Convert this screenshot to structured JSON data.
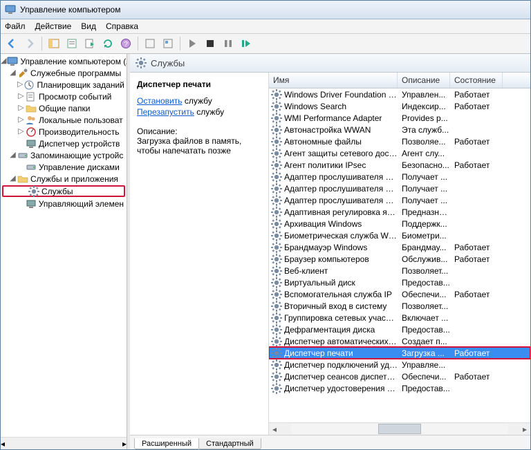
{
  "window": {
    "title": "Управление компьютером"
  },
  "menu": {
    "file": "Файл",
    "action": "Действие",
    "view": "Вид",
    "help": "Справка"
  },
  "tree": {
    "root": "Управление компьютером (л",
    "g1": "Служебные программы",
    "n1": "Планировщик заданий",
    "n2": "Просмотр событий",
    "n3": "Общие папки",
    "n4": "Локальные пользоват",
    "n5": "Производительность",
    "n6": "Диспетчер устройств",
    "g2": "Запоминающие устройс",
    "n7": "Управление дисками",
    "g3": "Службы и приложения",
    "n8": "Службы",
    "n9": "Управляющий элемен"
  },
  "panel": {
    "header": "Службы",
    "selected": "Диспетчер печати",
    "action1_link": "Остановить",
    "action1_rest": " службу",
    "action2_link": "Перезапустить",
    "action2_rest": " службу",
    "desc_h": "Описание:",
    "desc": "Загрузка файлов в память, чтобы напечатать позже"
  },
  "columns": {
    "name": "Имя",
    "desc": "Описание",
    "state": "Состояние"
  },
  "services": [
    {
      "n": "Windows Driver Foundation - User...",
      "d": "Управлен...",
      "s": "Работает"
    },
    {
      "n": "Windows Search",
      "d": "Индексир...",
      "s": "Работает"
    },
    {
      "n": "WMI Performance Adapter",
      "d": "Provides p...",
      "s": ""
    },
    {
      "n": "Автонастройка WWAN",
      "d": "Эта служб...",
      "s": ""
    },
    {
      "n": "Автономные файлы",
      "d": "Позволяе...",
      "s": "Работает"
    },
    {
      "n": "Агент защиты сетевого доступа",
      "d": "Агент слу...",
      "s": ""
    },
    {
      "n": "Агент политики IPsec",
      "d": "Безопасно...",
      "s": "Работает"
    },
    {
      "n": "Адаптер прослушивателя Net.M...",
      "d": "Получает ...",
      "s": ""
    },
    {
      "n": "Адаптер прослушивателя Net.Pipe",
      "d": "Получает ...",
      "s": ""
    },
    {
      "n": "Адаптер прослушивателя Net.Tcp",
      "d": "Получает ...",
      "s": ""
    },
    {
      "n": "Адаптивная регулировка яркости",
      "d": "Предназна...",
      "s": ""
    },
    {
      "n": "Архивация Windows",
      "d": "Поддержк...",
      "s": ""
    },
    {
      "n": "Биометрическая служба Windows",
      "d": "Биометри...",
      "s": ""
    },
    {
      "n": "Брандмауэр Windows",
      "d": "Брандмау...",
      "s": "Работает"
    },
    {
      "n": "Браузер компьютеров",
      "d": "Обслужив...",
      "s": "Работает"
    },
    {
      "n": "Веб-клиент",
      "d": "Позволяет...",
      "s": ""
    },
    {
      "n": "Виртуальный диск",
      "d": "Предостав...",
      "s": ""
    },
    {
      "n": "Вспомогательная служба IP",
      "d": "Обеспечи...",
      "s": "Работает"
    },
    {
      "n": "Вторичный вход в систему",
      "d": "Позволяет...",
      "s": ""
    },
    {
      "n": "Группировка сетевых участников",
      "d": "Включает ...",
      "s": ""
    },
    {
      "n": "Дефрагментация диска",
      "d": "Предостав...",
      "s": ""
    },
    {
      "n": "Диспетчер автоматических подк...",
      "d": "Создает п...",
      "s": ""
    },
    {
      "n": "Диспетчер печати",
      "d": "Загрузка ...",
      "s": "Работает",
      "sel": true,
      "hl": true
    },
    {
      "n": "Диспетчер подключений удален...",
      "d": "Управляе...",
      "s": ""
    },
    {
      "n": "Диспетчер сеансов диспетчера ...",
      "d": "Обеспечи...",
      "s": "Работает"
    },
    {
      "n": "Диспетчер удостоверения сетев...",
      "d": "Предостав...",
      "s": ""
    }
  ],
  "tabs": {
    "ext": "Расширенный",
    "std": "Стандартный"
  }
}
